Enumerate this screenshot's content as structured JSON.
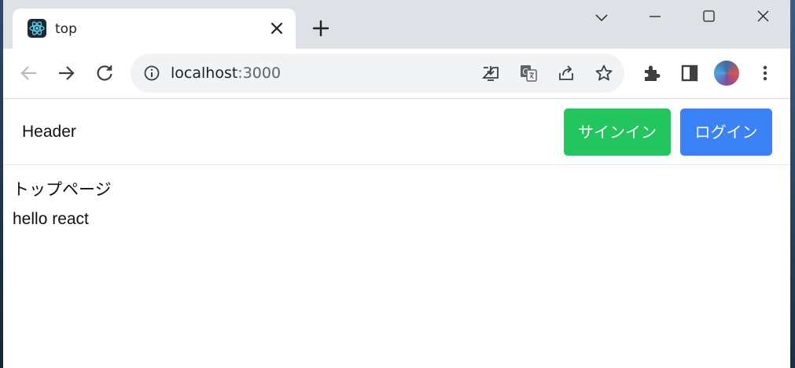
{
  "browser": {
    "tab": {
      "title": "top",
      "favicon": "react-icon",
      "close_glyph": "✕"
    },
    "new_tab_glyph": "+",
    "window_controls": {
      "menu": "chevron-down-icon",
      "minimize": "minimize-icon",
      "maximize": "maximize-icon",
      "close": "close-icon"
    },
    "address": {
      "host": "localhost",
      "port": ":3000"
    },
    "toolbar_icons": [
      "back-icon",
      "forward-icon",
      "reload-icon",
      "info-icon",
      "install-icon",
      "translate-icon",
      "share-icon",
      "star-icon",
      "extensions-icon",
      "side-panel-icon",
      "avatar",
      "more-icon"
    ]
  },
  "app": {
    "header": {
      "title": "Header",
      "signin_label": "サインイン",
      "login_label": "ログイン"
    },
    "content": {
      "page_name": "トップページ",
      "message": "hello react"
    }
  },
  "colors": {
    "signin_button": "#22c55e",
    "login_button": "#3b82f6",
    "tabstrip": "#dee1e6",
    "omnibox": "#f1f3f4"
  }
}
